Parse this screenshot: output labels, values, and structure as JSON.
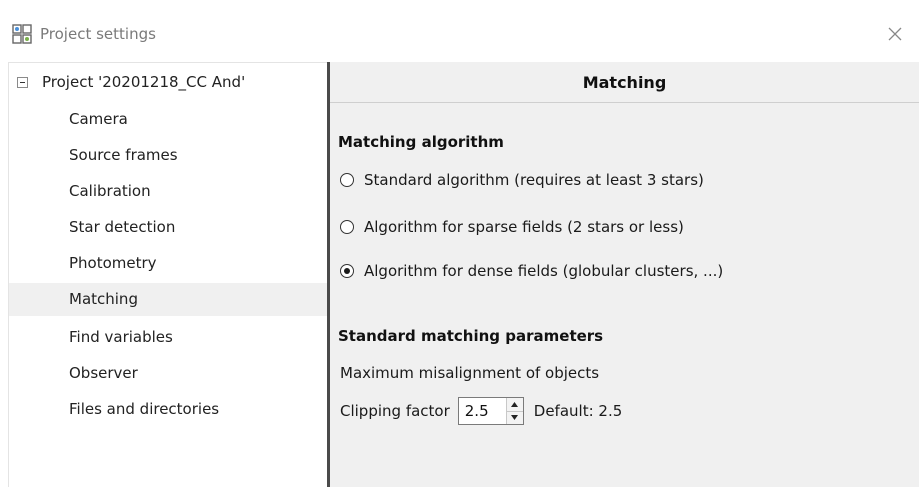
{
  "window": {
    "title": "Project settings",
    "icon": "project-grid-icon",
    "close_icon": "close-icon"
  },
  "tree": {
    "root_label": "Project '20201218_CC And'",
    "items": [
      {
        "label": "Camera"
      },
      {
        "label": "Source frames"
      },
      {
        "label": "Calibration"
      },
      {
        "label": "Star detection"
      },
      {
        "label": "Photometry"
      },
      {
        "label": "Matching",
        "selected": true
      },
      {
        "label": "Find variables"
      },
      {
        "label": "Observer"
      },
      {
        "label": "Files and directories"
      }
    ]
  },
  "panel": {
    "header": "Matching",
    "algorithm_section": {
      "title": "Matching algorithm",
      "options": [
        {
          "label": "Standard algorithm (requires at least 3 stars)",
          "checked": false
        },
        {
          "label": "Algorithm for sparse fields (2 stars or less)",
          "checked": false
        },
        {
          "label": "Algorithm for dense fields (globular clusters, ...)",
          "checked": true
        }
      ]
    },
    "parameters_section": {
      "title": "Standard matching parameters",
      "misalignment_label": "Maximum misalignment of objects",
      "clipping_label": "Clipping factor",
      "clipping_value": "2.5",
      "default_label": "Default: 2.5"
    }
  },
  "colors": {
    "panel_background": "#f0f0f0",
    "divider": "#4a4a4a",
    "selected_item": "#f0f0f0"
  }
}
